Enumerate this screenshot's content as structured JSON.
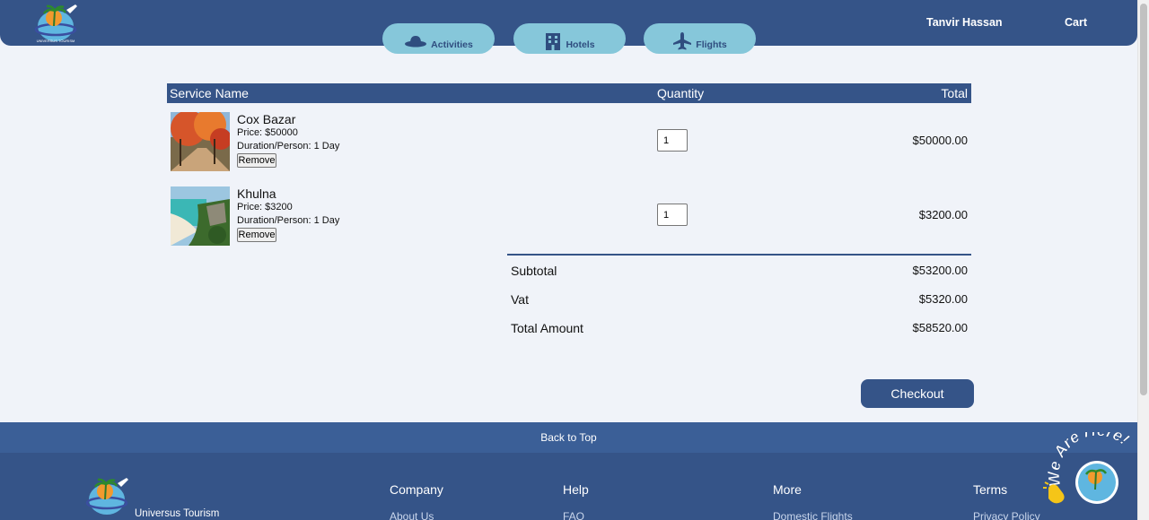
{
  "header": {
    "user_name": "Tanvir Hassan",
    "cart_label": "Cart",
    "nav": [
      {
        "label": "Activities",
        "icon": "hat-icon"
      },
      {
        "label": "Hotels",
        "icon": "building-icon"
      },
      {
        "label": "Flights",
        "icon": "airplane-icon"
      }
    ]
  },
  "table": {
    "col_service": "Service Name",
    "col_quantity": "Quantity",
    "col_total": "Total",
    "remove_label": "Remove",
    "items": [
      {
        "name": "Cox Bazar",
        "price": "Price: $50000",
        "duration": "Duration/Person: 1 Day",
        "quantity": "1",
        "total": "$50000.00"
      },
      {
        "name": "Khulna",
        "price": "Price: $3200",
        "duration": "Duration/Person: 1 Day",
        "quantity": "1",
        "total": "$3200.00"
      }
    ]
  },
  "summary": {
    "subtotal_label": "Subtotal",
    "subtotal": "$53200.00",
    "vat_label": "Vat",
    "vat": "$5320.00",
    "total_label": "Total Amount",
    "total": "$58520.00"
  },
  "checkout_label": "Checkout",
  "footer": {
    "back_to_top": "Back to Top",
    "brand": "Universus Tourism",
    "columns": [
      {
        "title": "Company",
        "link": "About Us"
      },
      {
        "title": "Help",
        "link": "FAQ"
      },
      {
        "title": "More",
        "link": "Domestic Flights"
      },
      {
        "title": "Terms",
        "link": "Privacy Policy"
      }
    ],
    "badge_text": "We Are Here!"
  },
  "colors": {
    "brand_navy": "#355488",
    "pill_blue": "#86c7da",
    "background": "#f0f3f9"
  }
}
